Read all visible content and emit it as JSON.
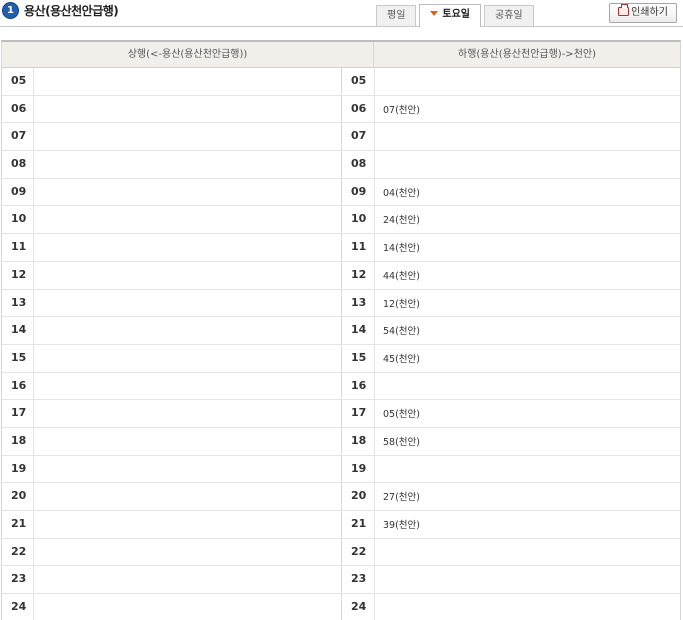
{
  "header": {
    "step_number": "1",
    "title": "용산(용산천안급행)",
    "tabs": [
      {
        "label": "평일",
        "active": false
      },
      {
        "label": "토요일",
        "active": true
      },
      {
        "label": "공휴일",
        "active": false
      }
    ],
    "print_label": "인쇄하기"
  },
  "table": {
    "column_up": "상행(<-용산(용산천안급행))",
    "column_down": "하행(용산(용산천안급행)->천안)",
    "rows": [
      {
        "hour": "05",
        "up": "",
        "down": ""
      },
      {
        "hour": "06",
        "up": "",
        "down": "07(천안)"
      },
      {
        "hour": "07",
        "up": "",
        "down": ""
      },
      {
        "hour": "08",
        "up": "",
        "down": ""
      },
      {
        "hour": "09",
        "up": "",
        "down": "04(천안)"
      },
      {
        "hour": "10",
        "up": "",
        "down": "24(천안)"
      },
      {
        "hour": "11",
        "up": "",
        "down": "14(천안)"
      },
      {
        "hour": "12",
        "up": "",
        "down": "44(천안)"
      },
      {
        "hour": "13",
        "up": "",
        "down": "12(천안)"
      },
      {
        "hour": "14",
        "up": "",
        "down": "54(천안)"
      },
      {
        "hour": "15",
        "up": "",
        "down": "45(천안)"
      },
      {
        "hour": "16",
        "up": "",
        "down": ""
      },
      {
        "hour": "17",
        "up": "",
        "down": "05(천안)"
      },
      {
        "hour": "18",
        "up": "",
        "down": "58(천안)"
      },
      {
        "hour": "19",
        "up": "",
        "down": ""
      },
      {
        "hour": "20",
        "up": "",
        "down": "27(천안)"
      },
      {
        "hour": "21",
        "up": "",
        "down": "39(천안)"
      },
      {
        "hour": "22",
        "up": "",
        "down": ""
      },
      {
        "hour": "23",
        "up": "",
        "down": ""
      },
      {
        "hour": "24",
        "up": "",
        "down": ""
      }
    ]
  }
}
